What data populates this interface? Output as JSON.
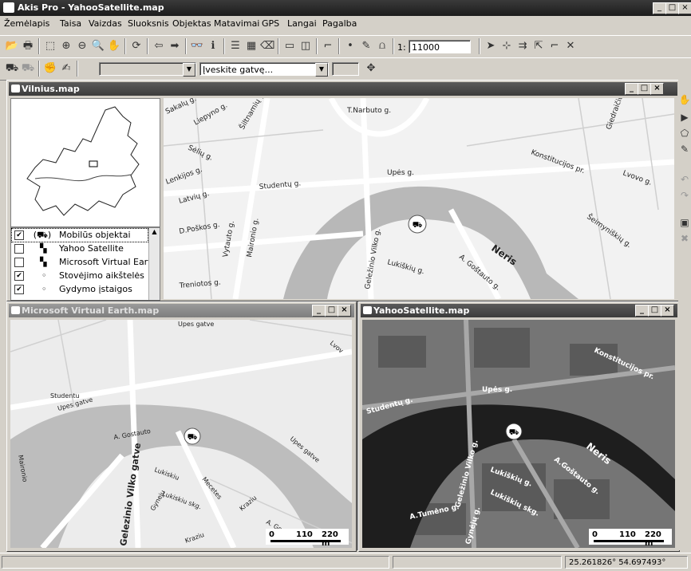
{
  "app": {
    "title": "Akis Pro - YahooSatellite.map"
  },
  "menu": [
    "Žemėlapis",
    "Taisa",
    "Vaizdas",
    "Sluoksnis",
    "Objektas",
    "Matavimai",
    "GPS",
    "Langai",
    "Pagalba"
  ],
  "toolbar": {
    "scale_prefix": "1:",
    "scale_value": "11000"
  },
  "toolbar2": {
    "street_placeholder": "Įveskite gatvę..."
  },
  "windows": {
    "vilnius": {
      "title": "Vilnius.map"
    },
    "virtual": {
      "title": "Microsoft Virtual Earth.map"
    },
    "yahoo": {
      "title": "YahooSatellite.map"
    }
  },
  "legend": [
    {
      "label": "Mobilūs objektai",
      "checked": true
    },
    {
      "label": "Yahoo Satellite",
      "checked": false
    },
    {
      "label": "Microsoft Virtual Earth",
      "checked": false
    },
    {
      "label": "Stovėjimo aikštelės",
      "checked": true
    },
    {
      "label": "Gydymo įstaigos",
      "checked": true
    }
  ],
  "vilnius_map_labels": [
    "T.Narbuto g.",
    "Sakalų g.",
    "Liepyno g.",
    "Šiltnamių g.",
    "Sėlių g.",
    "Lenkijos g.",
    "Latvių g.",
    "Studentų g.",
    "Upės g.",
    "Konstitucijos pr.",
    "Lvovo g.",
    "Giedraičių g.",
    "D.Poškos g.",
    "Vytauto g.",
    "Maironio g.",
    "Neris",
    "Šeimyniškių g.",
    "Treniotos g.",
    "Geležinio Vilko g.",
    "Lukiškių g.",
    "A. Goštauto g."
  ],
  "virtual_map_labels": [
    "Upes gatve",
    "Lvov",
    "Studentu",
    "Upes gatve",
    "A. Gostauto",
    "Upes gatve",
    "Maironio",
    "Lukiskiu",
    "Mecetes",
    "Gelezinio Vilko gatve",
    "Gyneju",
    "Lukiskiu skg.",
    "Kraziu",
    "A. Gostaut",
    "Kraziu"
  ],
  "yahoo_map_labels": [
    "Konstitucijos pr.",
    "Upės g.",
    "Studentų g.",
    "Neris",
    "Geležinio Vilko g.",
    "A.Goštauto g.",
    "Lukiškių g.",
    "Lukiškių skg.",
    "A.Tumėno g.",
    "Gynėjų g."
  ],
  "scale": {
    "zero": "0",
    "mid": "110",
    "end": "220 m"
  },
  "status": {
    "coords": "25.261826° 54.697493°"
  }
}
